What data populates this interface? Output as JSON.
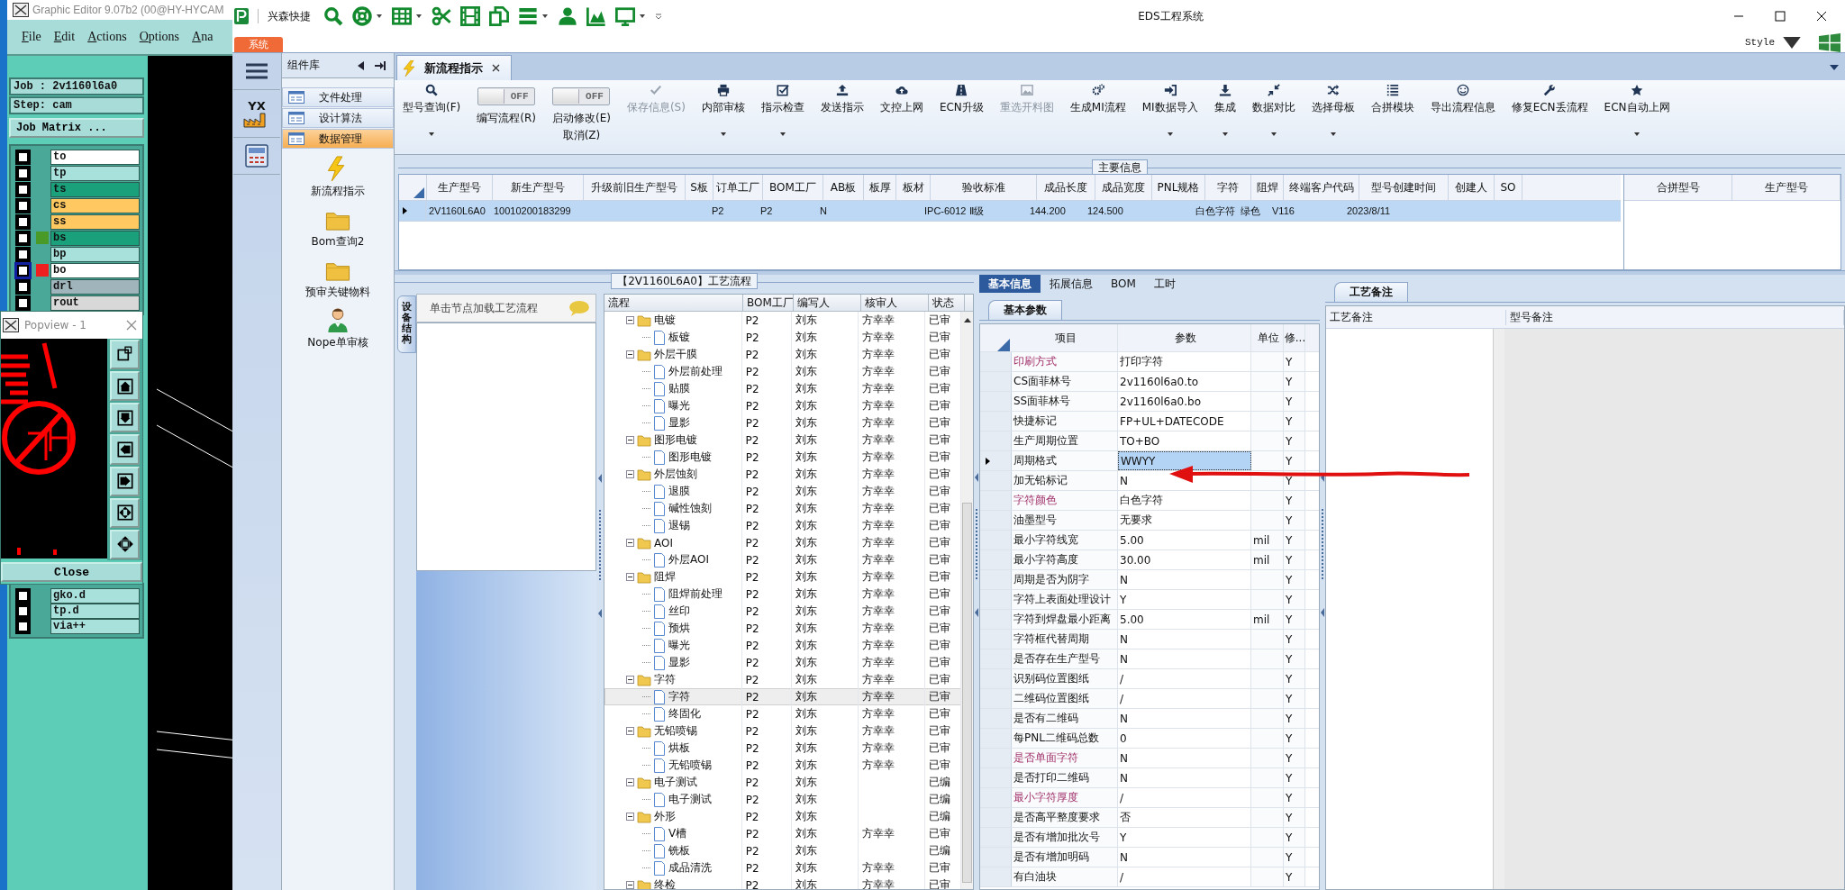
{
  "editor_window": {
    "title": "Graphic Editor 9.07b2 (00@HY-HYCAM",
    "menu": [
      "File",
      "Edit",
      "Actions",
      "Options",
      "Ana"
    ],
    "job": "Job : 2v1160l6a0",
    "step": "Step: cam",
    "matrix_button": "Job Matrix ...",
    "layers": [
      {
        "name": "to",
        "color": "#ffffff",
        "selected": false
      },
      {
        "name": "tp",
        "color": "#a8e0dc",
        "selected": false
      },
      {
        "name": "ts",
        "color": "#1aa07a",
        "selected": false
      },
      {
        "name": "cs",
        "color": "#ffc860",
        "selected": false
      },
      {
        "name": "ss",
        "color": "#ffc860",
        "selected": false
      },
      {
        "name": "bs",
        "color": "#1aa07a",
        "swatch": {
          "color": "#4a9a2a"
        },
        "selected": false
      },
      {
        "name": "bp",
        "color": "#a8e0dc",
        "selected": false
      },
      {
        "name": "bo",
        "color": "#ffffff",
        "swatch": {
          "color": "#ee2020"
        },
        "selected": true
      },
      {
        "name": "drl",
        "color": "#a0b4bc",
        "selected": false
      },
      {
        "name": "rout",
        "color": "#d8d8d8",
        "selected": false
      }
    ],
    "lower_layers": [
      {
        "name": "gko.d",
        "color": "#a8e0dc",
        "selected": false
      },
      {
        "name": "tp.d",
        "color": "#a8e0dc",
        "selected": false
      },
      {
        "name": "via++",
        "color": "#a8e0dc",
        "selected": false
      }
    ]
  },
  "popview": {
    "title": "Popview - 1",
    "close_button": "Close"
  },
  "window": {
    "title": "EDS工程系统",
    "app_name": "兴森快捷",
    "system_tab": "系统",
    "style_menu": "Style"
  },
  "icon_column": {
    "logo_text": "YX"
  },
  "sidebar": {
    "title": "组件库",
    "groups": [
      {
        "label": "文件处理",
        "selected": false
      },
      {
        "label": "设计算法",
        "selected": false
      },
      {
        "label": "数据管理",
        "selected": true
      }
    ],
    "items": [
      {
        "label": "新流程指示",
        "kind": "flash"
      },
      {
        "label": "Bom查询2",
        "kind": "folder"
      },
      {
        "label": "预审关键物料",
        "kind": "folder"
      },
      {
        "label": "Nope单审核",
        "kind": "person"
      }
    ]
  },
  "document_tab": {
    "label": "新流程指示",
    "selected": true
  },
  "ribbon": [
    {
      "kind": "button",
      "label": "型号查询(F)",
      "dropdown": true,
      "disabled": false
    },
    {
      "kind": "toggle",
      "label": "编写流程(R)",
      "switch_text": "OFF",
      "on": false
    },
    {
      "kind": "toggle",
      "label": "启动修改(E)",
      "sub_label": "取消(Z)",
      "switch_text": "OFF",
      "on": false
    },
    {
      "kind": "button",
      "label": "保存信息(S)",
      "dropdown": false,
      "disabled": true
    },
    {
      "kind": "button",
      "label": "内部审核",
      "dropdown": true,
      "disabled": false
    },
    {
      "kind": "button",
      "label": "指示检查",
      "dropdown": true,
      "disabled": false
    },
    {
      "kind": "button",
      "label": "发送指示",
      "dropdown": false,
      "disabled": false
    },
    {
      "kind": "button",
      "label": "文控上网",
      "dropdown": false,
      "disabled": false
    },
    {
      "kind": "button",
      "label": "ECN升级",
      "dropdown": false,
      "disabled": false
    },
    {
      "kind": "button",
      "label": "重选开料图",
      "dropdown": false,
      "disabled": true
    },
    {
      "kind": "button",
      "label": "生成MI流程",
      "dropdown": false,
      "disabled": false
    },
    {
      "kind": "button",
      "label": "MI数据导入",
      "dropdown": true,
      "disabled": false
    },
    {
      "kind": "button",
      "label": "集成",
      "dropdown": true,
      "disabled": false
    },
    {
      "kind": "button",
      "label": "数据对比",
      "dropdown": true,
      "disabled": false
    },
    {
      "kind": "button",
      "label": "选择母板",
      "dropdown": true,
      "disabled": false
    },
    {
      "kind": "button",
      "label": "合拼模块",
      "dropdown": false,
      "disabled": false
    },
    {
      "kind": "button",
      "label": "导出流程信息",
      "dropdown": false,
      "disabled": false
    },
    {
      "kind": "button",
      "label": "修复ECN丢流程",
      "dropdown": false,
      "disabled": false
    },
    {
      "kind": "button",
      "label": "ECN自动上网",
      "dropdown": true,
      "disabled": false
    }
  ],
  "main_info": {
    "title": "主要信息",
    "columns": [
      "生产型号",
      "新生产型号",
      "升级前旧生产型号",
      "S板",
      "订单工厂",
      "BOM工厂",
      "AB板",
      "板厚",
      "板材",
      "验收标准",
      "成品长度",
      "成品宽度",
      "PNL规格",
      "字符",
      "阻焊",
      "终端客户代码",
      "型号创建时间",
      "创建人",
      "SO"
    ],
    "rows": [
      {
        "selected": true,
        "cells": [
          "2V1160L6A0",
          "10010200183299",
          null,
          null,
          "P2",
          "P2",
          "N",
          null,
          null,
          "IPC-6012 Ⅱ级",
          "144.200",
          "124.500",
          null,
          "白色字符",
          "绿色",
          "V116",
          "2023/8/11",
          null,
          null
        ]
      }
    ],
    "side_columns": [
      "合拼型号",
      "生产型号"
    ]
  },
  "process": {
    "title": "【2V1160L6A0】工艺流程",
    "side_tab": "设备结构",
    "hint": "单击节点加载工艺流程",
    "columns": [
      "流程",
      "BOM工厂",
      "编写人",
      "核审人",
      "状态"
    ],
    "tree": [
      {
        "name": "电镀",
        "bom": "P2",
        "writer": "刘东",
        "reviewer": "方幸幸",
        "status": "已审",
        "expanded": true,
        "selected": false,
        "children": [
          {
            "name": "板镀",
            "bom": "P2",
            "writer": "刘东",
            "reviewer": "方幸幸",
            "status": "已审",
            "selected": false
          }
        ]
      },
      {
        "name": "外层干膜",
        "bom": "P2",
        "writer": "刘东",
        "reviewer": "方幸幸",
        "status": "已审",
        "expanded": true,
        "selected": false,
        "children": [
          {
            "name": "外层前处理",
            "bom": "P2",
            "writer": "刘东",
            "reviewer": "方幸幸",
            "status": "已审",
            "selected": false
          },
          {
            "name": "贴膜",
            "bom": "P2",
            "writer": "刘东",
            "reviewer": "方幸幸",
            "status": "已审",
            "selected": false
          },
          {
            "name": "曝光",
            "bom": "P2",
            "writer": "刘东",
            "reviewer": "方幸幸",
            "status": "已审",
            "selected": false
          },
          {
            "name": "显影",
            "bom": "P2",
            "writer": "刘东",
            "reviewer": "方幸幸",
            "status": "已审",
            "selected": false
          }
        ]
      },
      {
        "name": "图形电镀",
        "bom": "P2",
        "writer": "刘东",
        "reviewer": "方幸幸",
        "status": "已审",
        "expanded": true,
        "selected": false,
        "children": [
          {
            "name": "图形电镀",
            "bom": "P2",
            "writer": "刘东",
            "reviewer": "方幸幸",
            "status": "已审",
            "selected": false
          }
        ]
      },
      {
        "name": "外层蚀刻",
        "bom": "P2",
        "writer": "刘东",
        "reviewer": "方幸幸",
        "status": "已审",
        "expanded": true,
        "selected": false,
        "children": [
          {
            "name": "退膜",
            "bom": "P2",
            "writer": "刘东",
            "reviewer": "方幸幸",
            "status": "已审",
            "selected": false
          },
          {
            "name": "碱性蚀刻",
            "bom": "P2",
            "writer": "刘东",
            "reviewer": "方幸幸",
            "status": "已审",
            "selected": false
          },
          {
            "name": "退锡",
            "bom": "P2",
            "writer": "刘东",
            "reviewer": "方幸幸",
            "status": "已审",
            "selected": false
          }
        ]
      },
      {
        "name": "AOI",
        "bom": "P2",
        "writer": "刘东",
        "reviewer": "方幸幸",
        "status": "已审",
        "expanded": true,
        "selected": false,
        "children": [
          {
            "name": "外层AOI",
            "bom": "P2",
            "writer": "刘东",
            "reviewer": "方幸幸",
            "status": "已审",
            "selected": false
          }
        ]
      },
      {
        "name": "阻焊",
        "bom": "P2",
        "writer": "刘东",
        "reviewer": "方幸幸",
        "status": "已审",
        "expanded": true,
        "selected": false,
        "children": [
          {
            "name": "阻焊前处理",
            "bom": "P2",
            "writer": "刘东",
            "reviewer": "方幸幸",
            "status": "已审",
            "selected": false
          },
          {
            "name": "丝印",
            "bom": "P2",
            "writer": "刘东",
            "reviewer": "方幸幸",
            "status": "已审",
            "selected": false
          },
          {
            "name": "预烘",
            "bom": "P2",
            "writer": "刘东",
            "reviewer": "方幸幸",
            "status": "已审",
            "selected": false
          },
          {
            "name": "曝光",
            "bom": "P2",
            "writer": "刘东",
            "reviewer": "方幸幸",
            "status": "已审",
            "selected": false
          },
          {
            "name": "显影",
            "bom": "P2",
            "writer": "刘东",
            "reviewer": "方幸幸",
            "status": "已审",
            "selected": false
          }
        ]
      },
      {
        "name": "字符",
        "bom": "P2",
        "writer": "刘东",
        "reviewer": "方幸幸",
        "status": "已审",
        "expanded": true,
        "selected": false,
        "children": [
          {
            "name": "字符",
            "bom": "P2",
            "writer": "刘东",
            "reviewer": "方幸幸",
            "status": "已审",
            "selected": true
          },
          {
            "name": "终固化",
            "bom": "P2",
            "writer": "刘东",
            "reviewer": "方幸幸",
            "status": "已审",
            "selected": false
          }
        ]
      },
      {
        "name": "无铅喷锡",
        "bom": "P2",
        "writer": "刘东",
        "reviewer": "方幸幸",
        "status": "已审",
        "expanded": true,
        "selected": false,
        "children": [
          {
            "name": "烘板",
            "bom": "P2",
            "writer": "刘东",
            "reviewer": "方幸幸",
            "status": "已审",
            "selected": false
          },
          {
            "name": "无铅喷锡",
            "bom": "P2",
            "writer": "刘东",
            "reviewer": "方幸幸",
            "status": "已审",
            "selected": false
          }
        ]
      },
      {
        "name": "电子测试",
        "bom": "P2",
        "writer": "刘东",
        "status": "已编",
        "expanded": true,
        "selected": false,
        "children": [
          {
            "name": "电子测试",
            "bom": "P2",
            "writer": "刘东",
            "status": "已编",
            "selected": false
          }
        ]
      },
      {
        "name": "外形",
        "bom": "P2",
        "writer": "刘东",
        "status": "已编",
        "expanded": true,
        "selected": false,
        "children": [
          {
            "name": "V槽",
            "bom": "P2",
            "writer": "刘东",
            "reviewer": "方幸幸",
            "status": "已审",
            "selected": false
          },
          {
            "name": "铣板",
            "bom": "P2",
            "writer": "刘东",
            "status": "已编",
            "selected": false
          },
          {
            "name": "成品清洗",
            "bom": "P2",
            "writer": "刘东",
            "reviewer": "方幸幸",
            "status": "已审",
            "selected": false
          }
        ]
      },
      {
        "name": "终检",
        "bom": "P2",
        "writer": "刘东",
        "reviewer": "方幸幸",
        "status": "已审",
        "expanded": true,
        "selected": false
      }
    ]
  },
  "params": {
    "tabs": [
      {
        "label": "基本信息",
        "selected": true
      },
      {
        "label": "拓展信息",
        "selected": false
      },
      {
        "label": "BOM",
        "selected": false
      },
      {
        "label": "工时",
        "selected": false
      }
    ],
    "subtab": "基本参数",
    "columns": [
      "项目",
      "参数",
      "单位",
      "修..."
    ],
    "rows": [
      {
        "item": "印刷方式",
        "value": "打印字符",
        "modify": "Y",
        "highlighted": true,
        "selected": false
      },
      {
        "item": "CS面菲林号",
        "value": "2v1160l6a0.to",
        "modify": "Y",
        "highlighted": false,
        "selected": false
      },
      {
        "item": "SS面菲林号",
        "value": "2v1160l6a0.bo",
        "modify": "Y",
        "highlighted": false,
        "selected": false
      },
      {
        "item": "快捷标记",
        "value": "FP+UL+DATECODE",
        "modify": "Y",
        "highlighted": false,
        "selected": false
      },
      {
        "item": "生产周期位置",
        "value": "TO+BO",
        "modify": "Y",
        "highlighted": false,
        "selected": false
      },
      {
        "item": "周期格式",
        "value": "WWYY",
        "modify": "Y",
        "highlighted": false,
        "selected": true
      },
      {
        "item": "加无铅标记",
        "value": "N",
        "modify": "Y",
        "highlighted": false,
        "selected": false
      },
      {
        "item": "字符颜色",
        "value": "白色字符",
        "modify": "Y",
        "highlighted": true,
        "selected": false
      },
      {
        "item": "油墨型号",
        "value": "无要求",
        "modify": "Y",
        "highlighted": false,
        "selected": false
      },
      {
        "item": "最小字符线宽",
        "value": "5.00",
        "unit": "mil",
        "modify": "Y",
        "highlighted": false,
        "selected": false
      },
      {
        "item": "最小字符高度",
        "value": "30.00",
        "unit": "mil",
        "modify": "Y",
        "highlighted": false,
        "selected": false
      },
      {
        "item": "周期是否为阴字",
        "value": "N",
        "modify": "Y",
        "highlighted": false,
        "selected": false
      },
      {
        "item": "字符上表面处理设计",
        "value": "Y",
        "modify": "Y",
        "highlighted": false,
        "selected": false
      },
      {
        "item": "字符到焊盘最小距离",
        "value": "5.00",
        "unit": "mil",
        "modify": "Y",
        "highlighted": false,
        "selected": false
      },
      {
        "item": "字符框代替周期",
        "value": "N",
        "modify": "Y",
        "highlighted": false,
        "selected": false
      },
      {
        "item": "是否存在生产型号",
        "value": "N",
        "modify": "Y",
        "highlighted": false,
        "selected": false
      },
      {
        "item": "识别码位置图纸",
        "value": "/",
        "modify": "Y",
        "highlighted": false,
        "selected": false
      },
      {
        "item": "二维码位置图纸",
        "value": "/",
        "modify": "Y",
        "highlighted": false,
        "selected": false
      },
      {
        "item": "是否有二维码",
        "value": "N",
        "modify": "Y",
        "highlighted": false,
        "selected": false
      },
      {
        "item": "每PNL二维码总数",
        "value": "0",
        "modify": "Y",
        "highlighted": false,
        "selected": false
      },
      {
        "item": "是否单面字符",
        "value": "N",
        "modify": "Y",
        "highlighted": true,
        "selected": false
      },
      {
        "item": "是否打印二维码",
        "value": "N",
        "modify": "Y",
        "highlighted": false,
        "selected": false
      },
      {
        "item": "最小字符厚度",
        "value": "/",
        "modify": "Y",
        "highlighted": true,
        "selected": false
      },
      {
        "item": "是否高平整度要求",
        "value": "否",
        "modify": "Y",
        "highlighted": false,
        "selected": false
      },
      {
        "item": "是否有增加批次号",
        "value": "Y",
        "modify": "Y",
        "highlighted": false,
        "selected": false
      },
      {
        "item": "是否有增加明码",
        "value": "N",
        "modify": "Y",
        "highlighted": false,
        "selected": false
      },
      {
        "item": "有白油块",
        "value": "/",
        "modify": "Y",
        "highlighted": false,
        "selected": false
      }
    ]
  },
  "notes": {
    "tab": "工艺备注",
    "columns": [
      "工艺备注",
      "型号备注"
    ]
  }
}
